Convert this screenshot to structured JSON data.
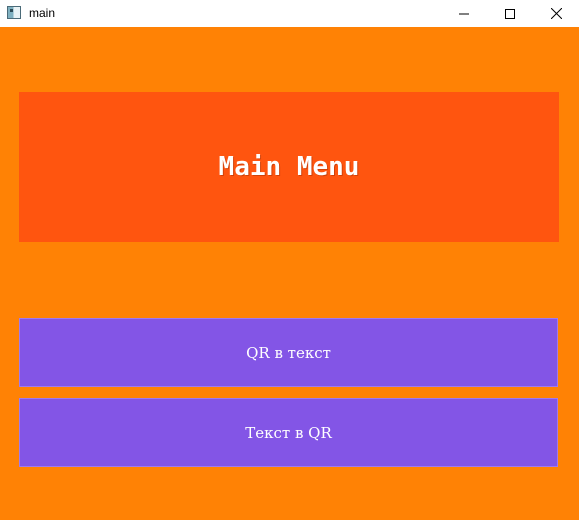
{
  "window": {
    "title": "main",
    "controls": {
      "minimize_icon": "minimize-icon",
      "maximize_icon": "maximize-icon",
      "close_icon": "close-icon"
    }
  },
  "header": {
    "title": "Main Menu"
  },
  "menu": {
    "buttons": [
      {
        "label": "QR в текст"
      },
      {
        "label": "Текст в QR"
      }
    ]
  },
  "colors": {
    "background": "#ff8205",
    "header_panel": "#ff550f",
    "button": "#8355e6",
    "text": "#ffffff"
  }
}
